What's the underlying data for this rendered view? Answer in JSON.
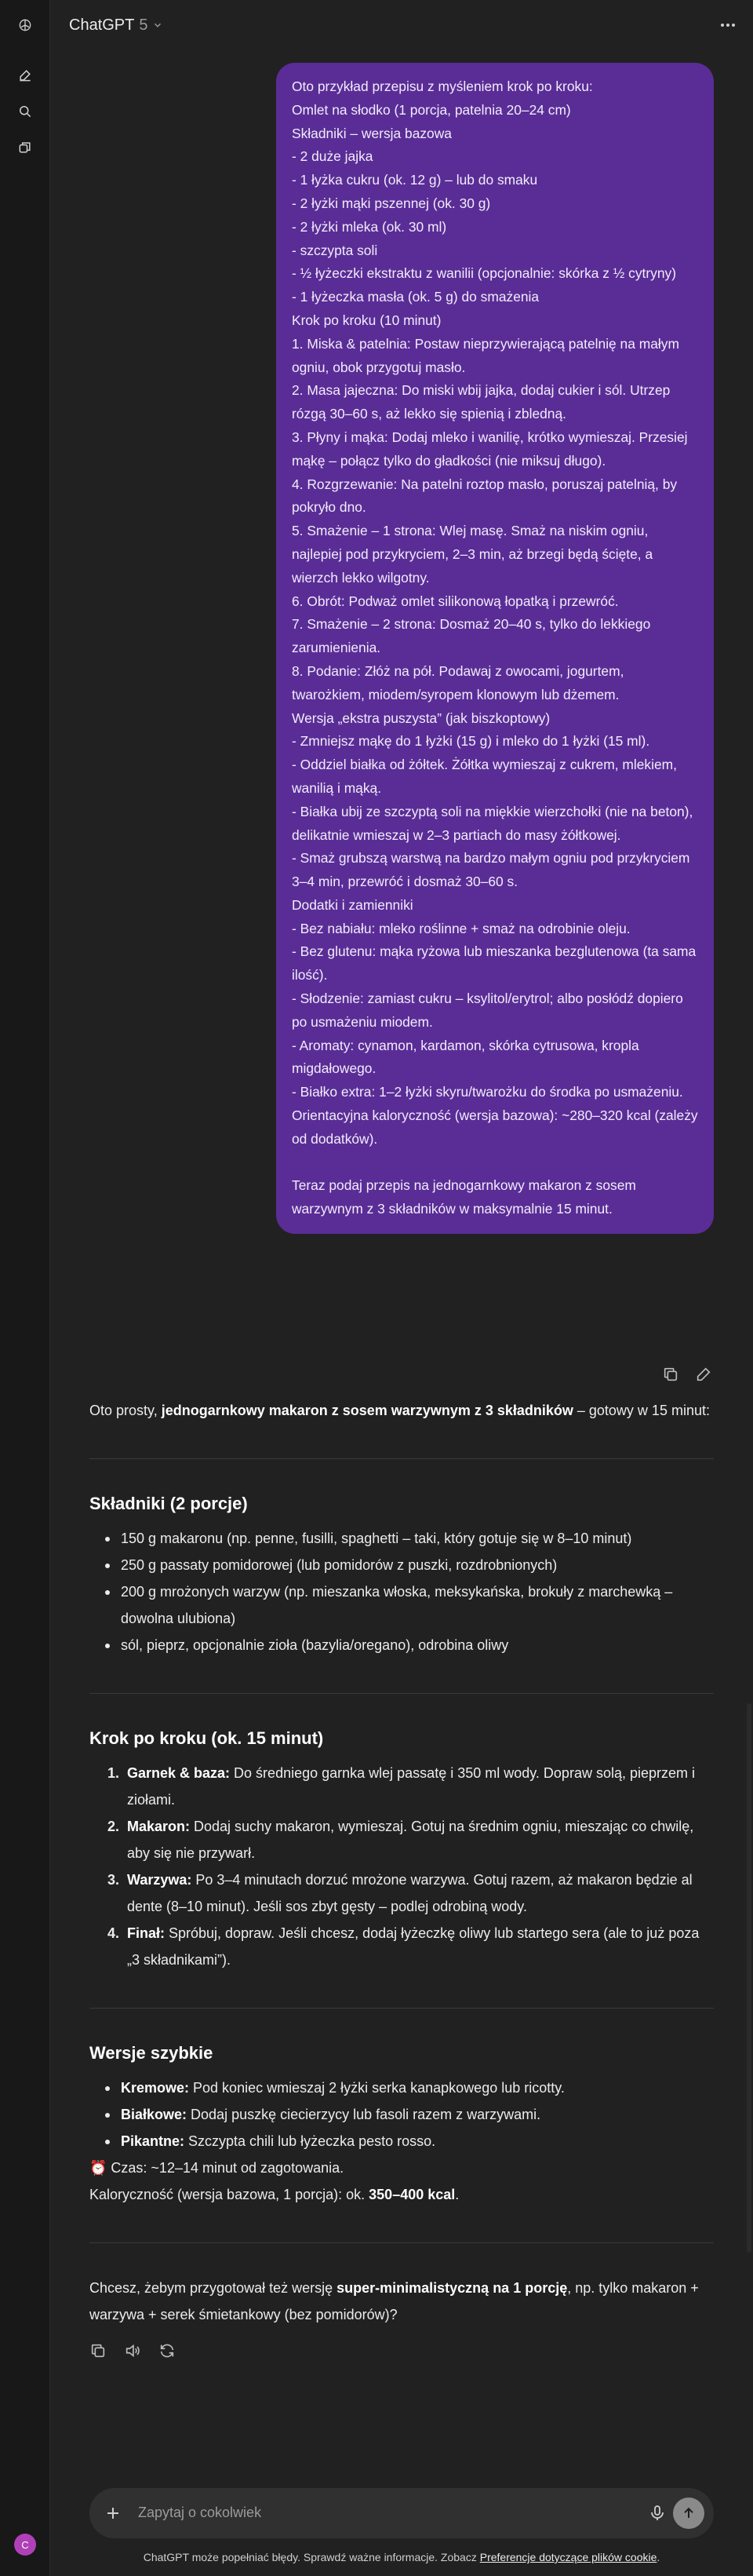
{
  "header": {
    "title": "ChatGPT",
    "version": "5"
  },
  "rail": {
    "avatar_letter": "C"
  },
  "user_message": {
    "lines": [
      "Oto przykład przepisu z myśleniem krok po kroku:",
      "Omlet na słodko (1 porcja, patelnia 20–24 cm)",
      "Składniki – wersja bazowa",
      "- 2 duże jajka",
      "- 1 łyżka cukru (ok. 12 g) – lub do smaku",
      "- 2 łyżki mąki pszennej (ok. 30 g)",
      "- 2 łyżki mleka (ok. 30 ml)",
      "- szczypta soli",
      "- ½ łyżeczki ekstraktu z wanilii (opcjonalnie: skórka z ½ cytryny)",
      "- 1 łyżeczka masła (ok. 5 g) do smażenia",
      "Krok po kroku (10 minut)",
      "1. Miska & patelnia: Postaw nieprzywierającą patelnię na małym ogniu, obok przygotuj masło.",
      "2. Masa jajeczna: Do miski wbij jajka, dodaj cukier i sól. Utrzep rózgą 30–60 s, aż lekko się spienią i zbledną.",
      "3. Płyny i mąka: Dodaj mleko i wanilię, krótko wymieszaj. Przesiej mąkę – połącz tylko do gładkości (nie miksuj długo).",
      "4. Rozgrzewanie: Na patelni roztop masło, poruszaj patelnią, by pokryło dno.",
      "5. Smażenie – 1 strona: Wlej masę. Smaż na niskim ogniu, najlepiej pod przykryciem, 2–3 min, aż brzegi będą ścięte, a wierzch lekko wilgotny.",
      "6. Obrót: Podważ omlet silikonową łopatką i przewróć.",
      "7. Smażenie – 2 strona: Dosmaż 20–40 s, tylko do lekkiego zarumienienia.",
      "8. Podanie: Złóż na pół. Podawaj z owocami, jogurtem, twarożkiem, miodem/syropem klonowym lub dżemem.",
      "Wersja „ekstra puszysta” (jak biszkoptowy)",
      "- Zmniejsz mąkę do 1 łyżki (15 g) i mleko do 1 łyżki (15 ml).",
      "- Oddziel białka od żółtek. Żółtka wymieszaj z cukrem, mlekiem, wanilią i mąką.",
      "- Białka ubij ze szczyptą soli na miękkie wierzchołki (nie na beton), delikatnie wmieszaj w 2–3 partiach do masy żółtkowej.",
      "- Smaż grubszą warstwą na bardzo małym ogniu pod przykryciem 3–4 min, przewróć i dosmaż 30–60 s.",
      "Dodatki i zamienniki",
      "- Bez nabiału: mleko roślinne + smaż na odrobinie oleju.",
      "- Bez glutenu: mąka ryżowa lub mieszanka bezglutenowa (ta sama ilość).",
      "- Słodzenie: zamiast cukru – ksylitol/erytrol; albo posłódź dopiero po usmażeniu miodem.",
      "- Aromaty: cynamon, kardamon, skórka cytrusowa, kropla migdałowego.",
      "- Białko extra: 1–2 łyżki skyru/twarożku do środka po usmażeniu.",
      "Orientacyjna kaloryczność (wersja bazowa): ~280–320 kcal (zależy od dodatków).",
      "",
      "Teraz podaj przepis na jednogarnkowy makaron z sosem warzywnym z 3 składników w maksymalnie 15 minut."
    ]
  },
  "assistant": {
    "intro_pre": "Oto prosty, ",
    "intro_bold": "jednogarnkowy makaron z sosem warzywnym z 3 składników",
    "intro_post": " – gotowy w 15 minut:",
    "ingredients_heading": "Składniki (2 porcje)",
    "ingredients": [
      "150 g makaronu (np. penne, fusilli, spaghetti – taki, który gotuje się w 8–10 minut)",
      "250 g passaty pomidorowej (lub pomidorów z puszki, rozdrobnionych)",
      "200 g mrożonych warzyw (np. mieszanka włoska, meksykańska, brokuły z marchewką – dowolna ulubiona)",
      "sól, pieprz, opcjonalnie zioła (bazylia/oregano), odrobina oliwy"
    ],
    "steps_heading": "Krok po kroku (ok. 15 minut)",
    "steps": [
      {
        "num": "1.",
        "label": "Garnek & baza:",
        "text": " Do średniego garnka wlej passatę i 350 ml wody. Dopraw solą, pieprzem i ziołami."
      },
      {
        "num": "2.",
        "label": "Makaron:",
        "text": " Dodaj suchy makaron, wymieszaj. Gotuj na średnim ogniu, mieszając co chwilę, aby się nie przywarł."
      },
      {
        "num": "3.",
        "label": "Warzywa:",
        "text": " Po 3–4 minutach dorzuć mrożone warzywa. Gotuj razem, aż makaron będzie al dente (8–10 minut). Jeśli sos zbyt gęsty – podlej odrobiną wody."
      },
      {
        "num": "4.",
        "label": "Finał:",
        "text": " Spróbuj, dopraw. Jeśli chcesz, dodaj łyżeczkę oliwy lub startego sera (ale to już poza „3 składnikami”)."
      }
    ],
    "variants_heading": "Wersje szybkie",
    "variants": [
      {
        "label": "Kremowe:",
        "text": " Pod koniec wmieszaj 2 łyżki serka kanapkowego lub ricotty."
      },
      {
        "label": "Białkowe:",
        "text": " Dodaj puszkę ciecierzycy lub fasoli razem z warzywami."
      },
      {
        "label": "Pikantne:",
        "text": " Szczypta chili lub łyżeczka pesto rosso."
      }
    ],
    "time_line": "⏰ Czas: ~12–14 minut od zagotowania.",
    "kcal_pre": "Kaloryczność (wersja bazowa, 1 porcja): ok. ",
    "kcal_bold": "350–400 kcal",
    "kcal_post": ".",
    "question_pre": "Chcesz, żebym przygotował też wersję ",
    "question_bold": "super-minimalistyczną na 1 porcję",
    "question_post": ", np. tylko makaron + warzywa + serek śmietankowy (bez pomidorów)?"
  },
  "composer": {
    "placeholder": "Zapytaj o cokolwiek"
  },
  "footer": {
    "disclaimer_pre": "ChatGPT może popełniać błędy. Sprawdź ważne informacje. Zobacz ",
    "disclaimer_link": "Preferencje dotyczące plików cookie",
    "disclaimer_post": "."
  },
  "colors": {
    "background": "#212121",
    "user_bubble": "#5a2d96",
    "avatar": "#b040b8"
  }
}
